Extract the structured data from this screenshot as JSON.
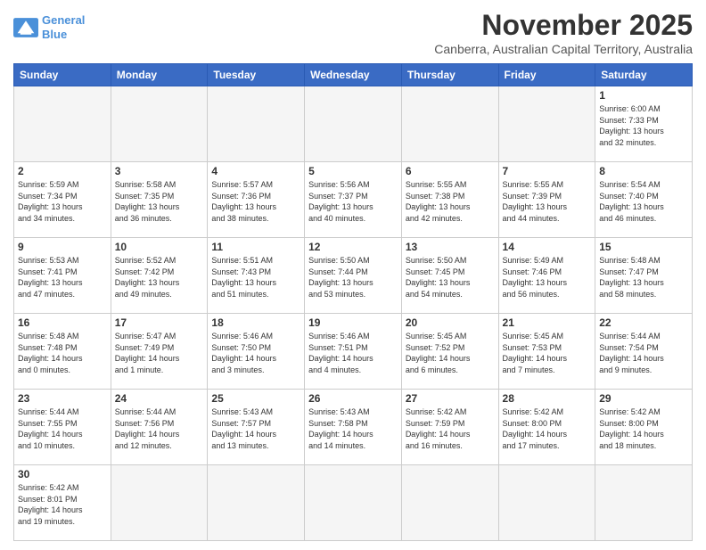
{
  "header": {
    "logo_line1": "General",
    "logo_line2": "Blue",
    "main_title": "November 2025",
    "subtitle": "Canberra, Australian Capital Territory, Australia"
  },
  "days_of_week": [
    "Sunday",
    "Monday",
    "Tuesday",
    "Wednesday",
    "Thursday",
    "Friday",
    "Saturday"
  ],
  "weeks": [
    [
      {
        "day": "",
        "info": ""
      },
      {
        "day": "",
        "info": ""
      },
      {
        "day": "",
        "info": ""
      },
      {
        "day": "",
        "info": ""
      },
      {
        "day": "",
        "info": ""
      },
      {
        "day": "",
        "info": ""
      },
      {
        "day": "1",
        "info": "Sunrise: 6:00 AM\nSunset: 7:33 PM\nDaylight: 13 hours\nand 32 minutes."
      }
    ],
    [
      {
        "day": "2",
        "info": "Sunrise: 5:59 AM\nSunset: 7:34 PM\nDaylight: 13 hours\nand 34 minutes."
      },
      {
        "day": "3",
        "info": "Sunrise: 5:58 AM\nSunset: 7:35 PM\nDaylight: 13 hours\nand 36 minutes."
      },
      {
        "day": "4",
        "info": "Sunrise: 5:57 AM\nSunset: 7:36 PM\nDaylight: 13 hours\nand 38 minutes."
      },
      {
        "day": "5",
        "info": "Sunrise: 5:56 AM\nSunset: 7:37 PM\nDaylight: 13 hours\nand 40 minutes."
      },
      {
        "day": "6",
        "info": "Sunrise: 5:55 AM\nSunset: 7:38 PM\nDaylight: 13 hours\nand 42 minutes."
      },
      {
        "day": "7",
        "info": "Sunrise: 5:55 AM\nSunset: 7:39 PM\nDaylight: 13 hours\nand 44 minutes."
      },
      {
        "day": "8",
        "info": "Sunrise: 5:54 AM\nSunset: 7:40 PM\nDaylight: 13 hours\nand 46 minutes."
      }
    ],
    [
      {
        "day": "9",
        "info": "Sunrise: 5:53 AM\nSunset: 7:41 PM\nDaylight: 13 hours\nand 47 minutes."
      },
      {
        "day": "10",
        "info": "Sunrise: 5:52 AM\nSunset: 7:42 PM\nDaylight: 13 hours\nand 49 minutes."
      },
      {
        "day": "11",
        "info": "Sunrise: 5:51 AM\nSunset: 7:43 PM\nDaylight: 13 hours\nand 51 minutes."
      },
      {
        "day": "12",
        "info": "Sunrise: 5:50 AM\nSunset: 7:44 PM\nDaylight: 13 hours\nand 53 minutes."
      },
      {
        "day": "13",
        "info": "Sunrise: 5:50 AM\nSunset: 7:45 PM\nDaylight: 13 hours\nand 54 minutes."
      },
      {
        "day": "14",
        "info": "Sunrise: 5:49 AM\nSunset: 7:46 PM\nDaylight: 13 hours\nand 56 minutes."
      },
      {
        "day": "15",
        "info": "Sunrise: 5:48 AM\nSunset: 7:47 PM\nDaylight: 13 hours\nand 58 minutes."
      }
    ],
    [
      {
        "day": "16",
        "info": "Sunrise: 5:48 AM\nSunset: 7:48 PM\nDaylight: 14 hours\nand 0 minutes."
      },
      {
        "day": "17",
        "info": "Sunrise: 5:47 AM\nSunset: 7:49 PM\nDaylight: 14 hours\nand 1 minute."
      },
      {
        "day": "18",
        "info": "Sunrise: 5:46 AM\nSunset: 7:50 PM\nDaylight: 14 hours\nand 3 minutes."
      },
      {
        "day": "19",
        "info": "Sunrise: 5:46 AM\nSunset: 7:51 PM\nDaylight: 14 hours\nand 4 minutes."
      },
      {
        "day": "20",
        "info": "Sunrise: 5:45 AM\nSunset: 7:52 PM\nDaylight: 14 hours\nand 6 minutes."
      },
      {
        "day": "21",
        "info": "Sunrise: 5:45 AM\nSunset: 7:53 PM\nDaylight: 14 hours\nand 7 minutes."
      },
      {
        "day": "22",
        "info": "Sunrise: 5:44 AM\nSunset: 7:54 PM\nDaylight: 14 hours\nand 9 minutes."
      }
    ],
    [
      {
        "day": "23",
        "info": "Sunrise: 5:44 AM\nSunset: 7:55 PM\nDaylight: 14 hours\nand 10 minutes."
      },
      {
        "day": "24",
        "info": "Sunrise: 5:44 AM\nSunset: 7:56 PM\nDaylight: 14 hours\nand 12 minutes."
      },
      {
        "day": "25",
        "info": "Sunrise: 5:43 AM\nSunset: 7:57 PM\nDaylight: 14 hours\nand 13 minutes."
      },
      {
        "day": "26",
        "info": "Sunrise: 5:43 AM\nSunset: 7:58 PM\nDaylight: 14 hours\nand 14 minutes."
      },
      {
        "day": "27",
        "info": "Sunrise: 5:42 AM\nSunset: 7:59 PM\nDaylight: 14 hours\nand 16 minutes."
      },
      {
        "day": "28",
        "info": "Sunrise: 5:42 AM\nSunset: 8:00 PM\nDaylight: 14 hours\nand 17 minutes."
      },
      {
        "day": "29",
        "info": "Sunrise: 5:42 AM\nSunset: 8:00 PM\nDaylight: 14 hours\nand 18 minutes."
      }
    ],
    [
      {
        "day": "30",
        "info": "Sunrise: 5:42 AM\nSunset: 8:01 PM\nDaylight: 14 hours\nand 19 minutes."
      },
      {
        "day": "",
        "info": ""
      },
      {
        "day": "",
        "info": ""
      },
      {
        "day": "",
        "info": ""
      },
      {
        "day": "",
        "info": ""
      },
      {
        "day": "",
        "info": ""
      },
      {
        "day": "",
        "info": ""
      }
    ]
  ]
}
